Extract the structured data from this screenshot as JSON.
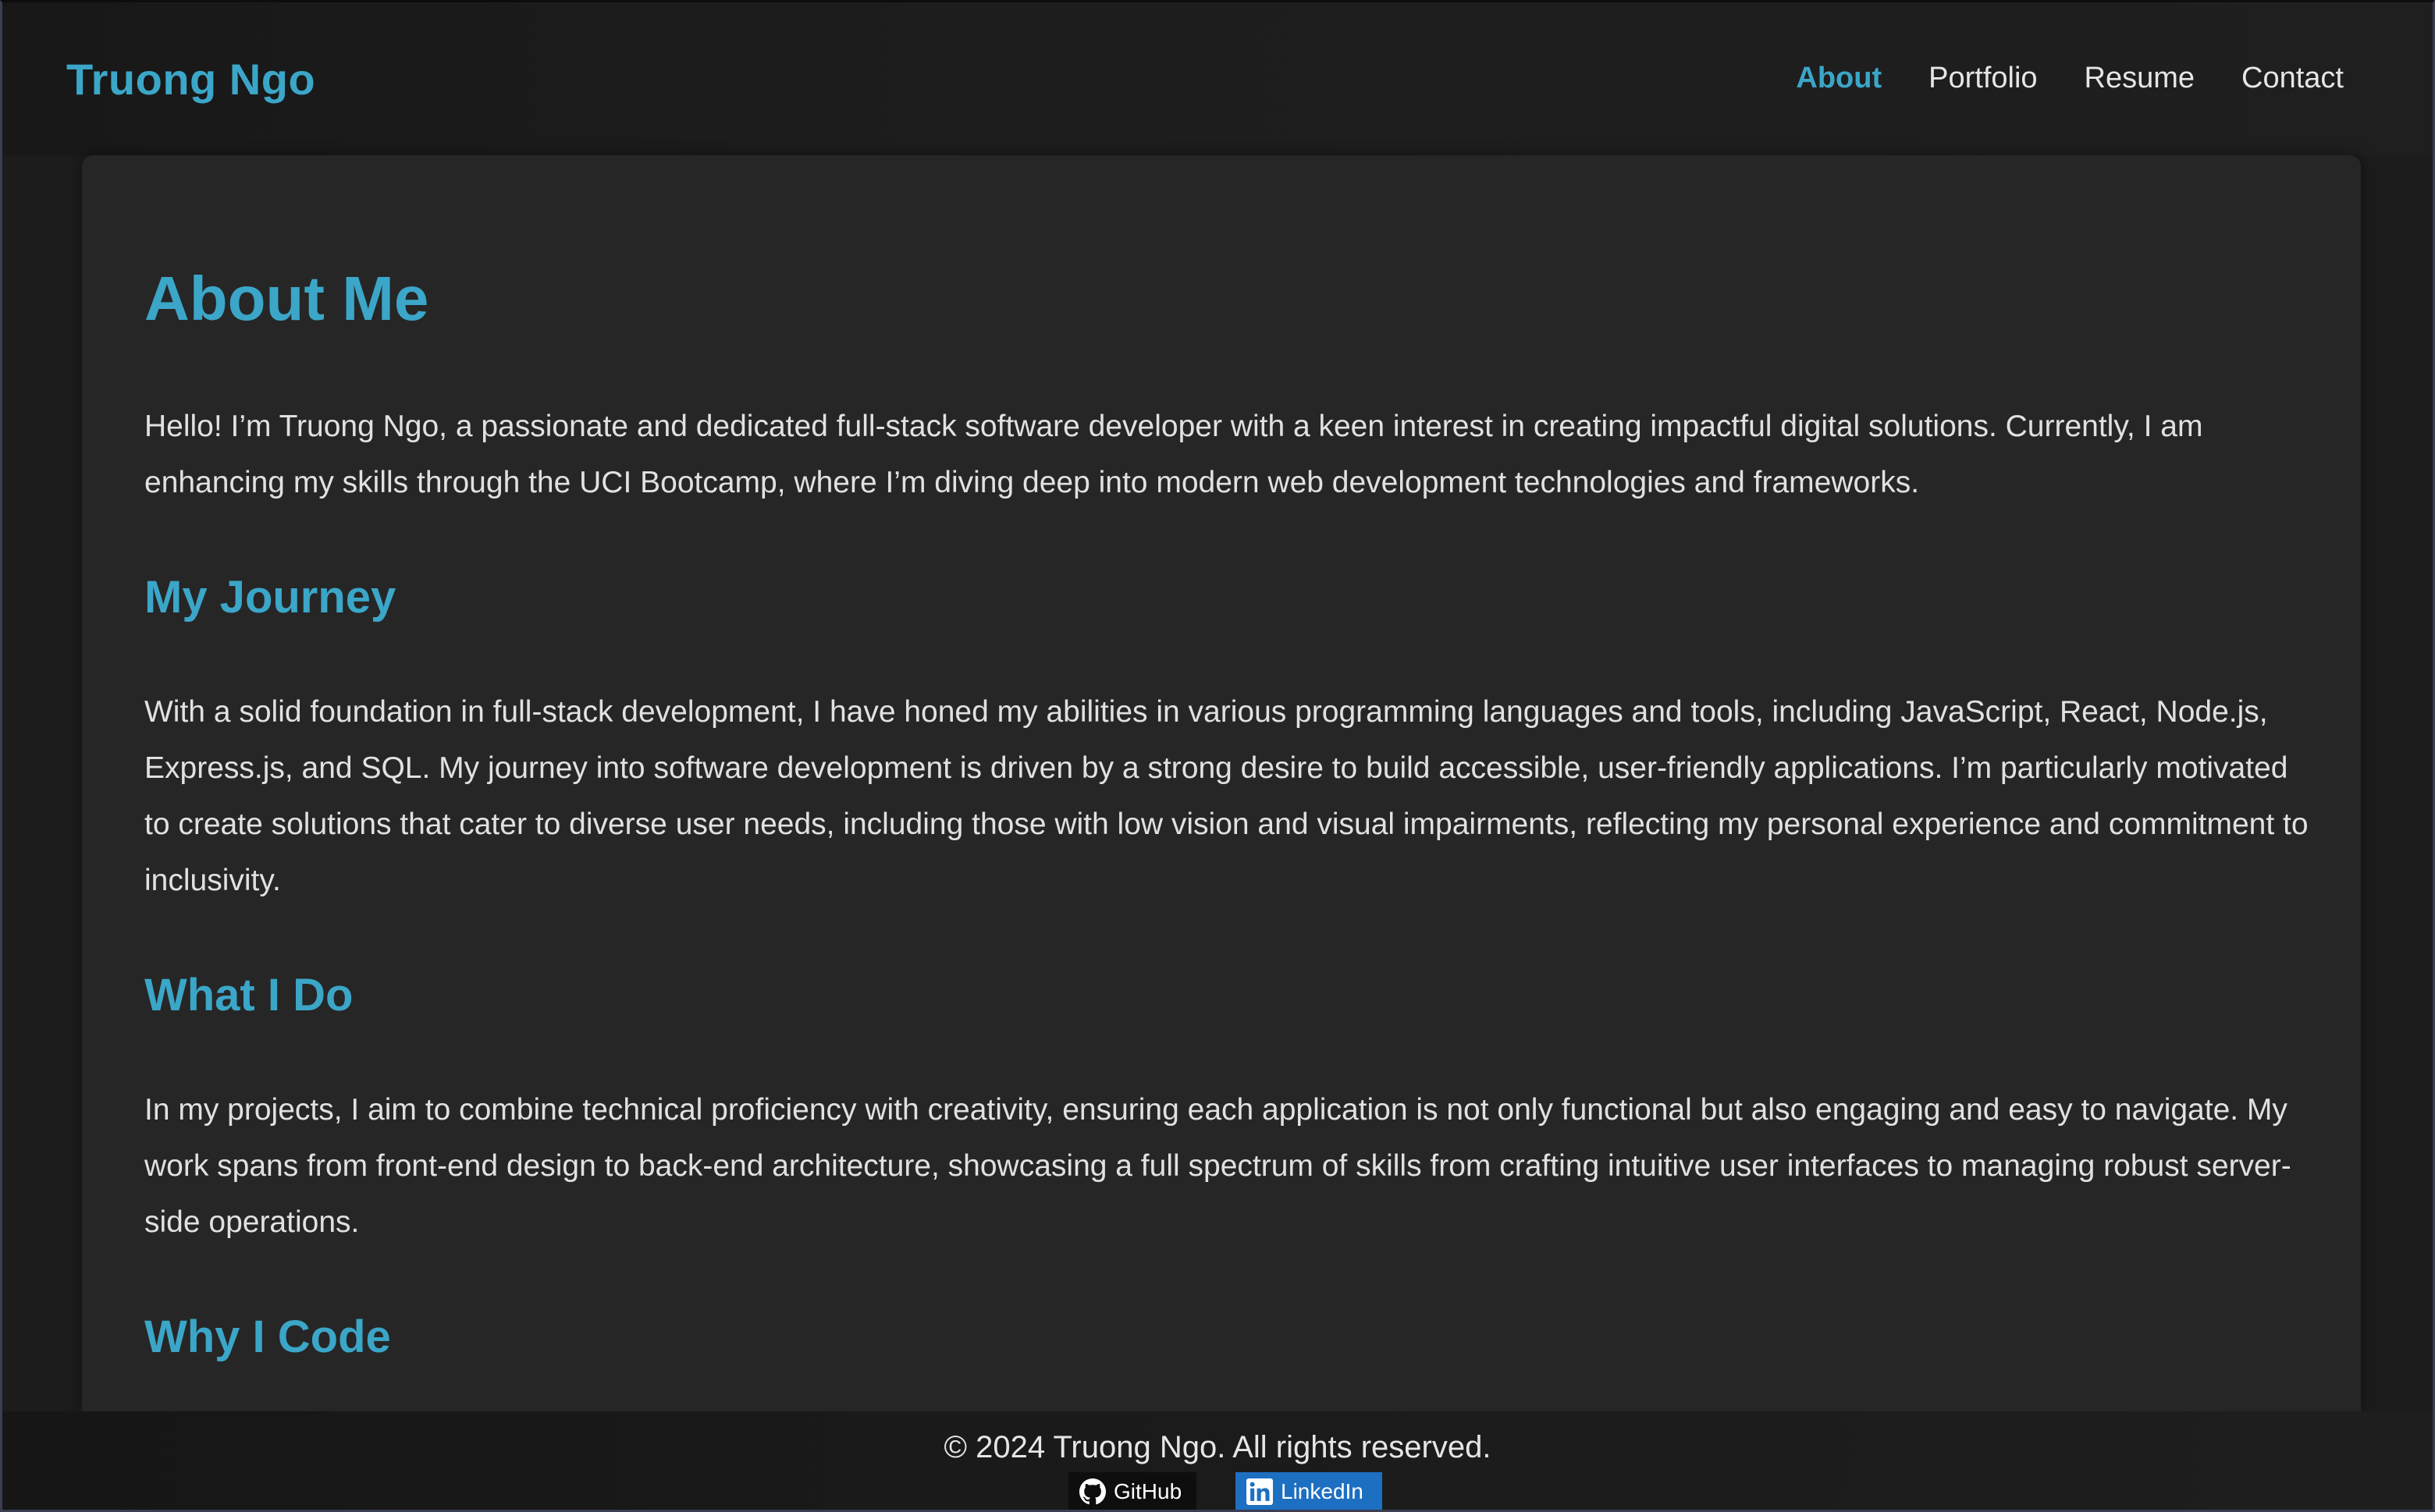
{
  "header": {
    "brand": "Truong Ngo",
    "nav": [
      {
        "label": "About",
        "active": true
      },
      {
        "label": "Portfolio",
        "active": false
      },
      {
        "label": "Resume",
        "active": false
      },
      {
        "label": "Contact",
        "active": false
      }
    ]
  },
  "main": {
    "title": "About Me",
    "intro": "Hello! I’m Truong Ngo, a passionate and dedicated full-stack software developer with a keen interest in creating impactful digital solutions. Currently, I am enhancing my skills through the UCI Bootcamp, where I’m diving deep into modern web development technologies and frameworks.",
    "sections": [
      {
        "heading": "My Journey",
        "body": "With a solid foundation in full-stack development, I have honed my abilities in various programming languages and tools, including JavaScript, React, Node.js, Express.js, and SQL. My journey into software development is driven by a strong desire to build accessible, user-friendly applications. I’m particularly motivated to create solutions that cater to diverse user needs, including those with low vision and visual impairments, reflecting my personal experience and commitment to inclusivity."
      },
      {
        "heading": "What I Do",
        "body": "In my projects, I aim to combine technical proficiency with creativity, ensuring each application is not only functional but also engaging and easy to navigate. My work spans from front-end design to back-end architecture, showcasing a full spectrum of skills from crafting intuitive user interfaces to managing robust server-side operations."
      },
      {
        "heading": "Why I Code",
        "body": ""
      }
    ]
  },
  "footer": {
    "copyright": "© 2024 Truong Ngo. All rights reserved.",
    "badges": [
      {
        "label": "GitHub",
        "icon": "github-icon",
        "color": "#0e0e0e"
      },
      {
        "label": "LinkedIn",
        "icon": "linkedin-icon",
        "color": "#1d6fc1"
      }
    ]
  },
  "colors": {
    "accent": "#3ba6c8",
    "background": "#1c1c1c",
    "card": "#262626",
    "text": "#e1e1e1"
  }
}
